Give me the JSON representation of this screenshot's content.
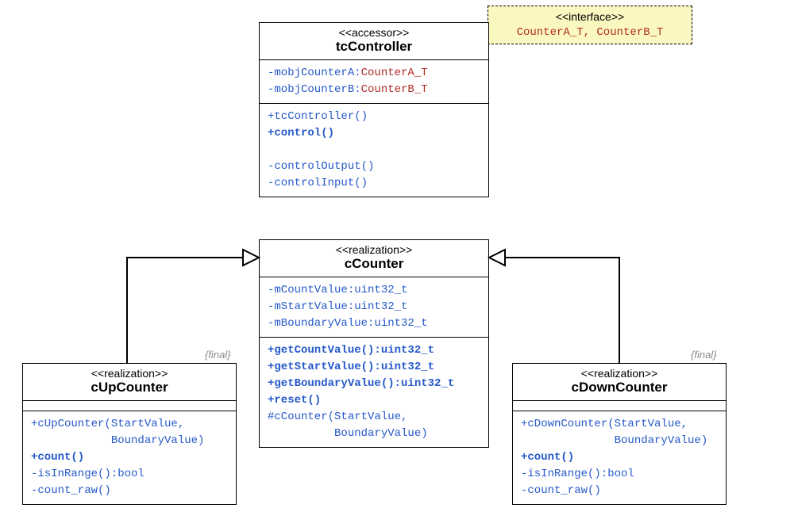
{
  "note": {
    "stereotype": "<<interface>>",
    "ifaceA": "CounterA_T",
    "ifaceB": "CounterB_T",
    "sep": ", "
  },
  "tcController": {
    "stereotype": "<<accessor>>",
    "name": "tcController",
    "attrs": {
      "a_pre": "-mobjCounterA:",
      "a_type": "CounterA_T",
      "b_pre": "-mobjCounterB:",
      "b_type": "CounterB_T"
    },
    "ops": {
      "ctor": "+tcController()",
      "control": "+control()",
      "out": "-controlOutput()",
      "in": "-controlInput()"
    }
  },
  "cCounter": {
    "stereotype": "<<realization>>",
    "name": "cCounter",
    "attrs": {
      "cv": "-mCountValue:uint32_t",
      "sv": "-mStartValue:uint32_t",
      "bv": "-mBoundaryValue:uint32_t"
    },
    "ops": {
      "gcv": "+getCountValue():uint32_t",
      "gsv": "+getStartValue():uint32_t",
      "gbv": "+getBoundaryValue():uint32_t",
      "reset": "+reset()",
      "ctor1": "#cCounter(StartValue,",
      "ctor2": "          BoundaryValue)"
    }
  },
  "cUpCounter": {
    "stereotype": "<<realization>>",
    "name": "cUpCounter",
    "final": "{final}",
    "ops": {
      "ctor1": "+cUpCounter(StartValue,",
      "ctor2": "            BoundaryValue)",
      "count": "+count()",
      "range": "-isInRange():bool",
      "raw": "-count_raw()"
    }
  },
  "cDownCounter": {
    "stereotype": "<<realization>>",
    "name": "cDownCounter",
    "final": "{final}",
    "ops": {
      "ctor1": "+cDownCounter(StartValue,",
      "ctor2": "              BoundaryValue)",
      "count": "+count()",
      "range": "-isInRange():bool",
      "raw": "-count_raw()"
    }
  }
}
